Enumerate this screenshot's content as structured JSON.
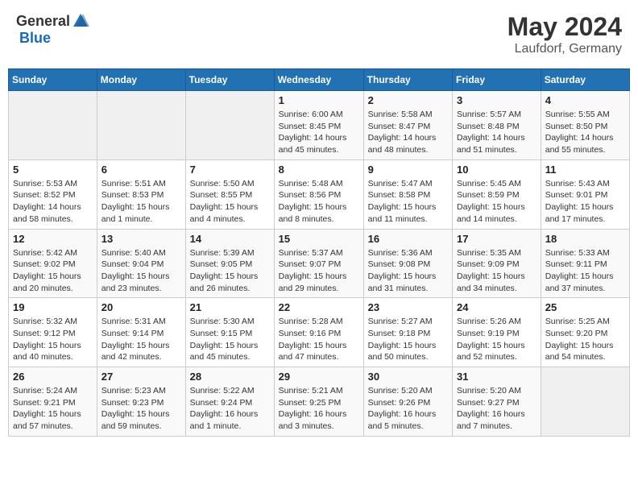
{
  "header": {
    "logo_general": "General",
    "logo_blue": "Blue",
    "month": "May 2024",
    "location": "Laufdorf, Germany"
  },
  "days_of_week": [
    "Sunday",
    "Monday",
    "Tuesday",
    "Wednesday",
    "Thursday",
    "Friday",
    "Saturday"
  ],
  "weeks": [
    [
      {
        "day": "",
        "info": ""
      },
      {
        "day": "",
        "info": ""
      },
      {
        "day": "",
        "info": ""
      },
      {
        "day": "1",
        "info": "Sunrise: 6:00 AM\nSunset: 8:45 PM\nDaylight: 14 hours\nand 45 minutes."
      },
      {
        "day": "2",
        "info": "Sunrise: 5:58 AM\nSunset: 8:47 PM\nDaylight: 14 hours\nand 48 minutes."
      },
      {
        "day": "3",
        "info": "Sunrise: 5:57 AM\nSunset: 8:48 PM\nDaylight: 14 hours\nand 51 minutes."
      },
      {
        "day": "4",
        "info": "Sunrise: 5:55 AM\nSunset: 8:50 PM\nDaylight: 14 hours\nand 55 minutes."
      }
    ],
    [
      {
        "day": "5",
        "info": "Sunrise: 5:53 AM\nSunset: 8:52 PM\nDaylight: 14 hours\nand 58 minutes."
      },
      {
        "day": "6",
        "info": "Sunrise: 5:51 AM\nSunset: 8:53 PM\nDaylight: 15 hours\nand 1 minute."
      },
      {
        "day": "7",
        "info": "Sunrise: 5:50 AM\nSunset: 8:55 PM\nDaylight: 15 hours\nand 4 minutes."
      },
      {
        "day": "8",
        "info": "Sunrise: 5:48 AM\nSunset: 8:56 PM\nDaylight: 15 hours\nand 8 minutes."
      },
      {
        "day": "9",
        "info": "Sunrise: 5:47 AM\nSunset: 8:58 PM\nDaylight: 15 hours\nand 11 minutes."
      },
      {
        "day": "10",
        "info": "Sunrise: 5:45 AM\nSunset: 8:59 PM\nDaylight: 15 hours\nand 14 minutes."
      },
      {
        "day": "11",
        "info": "Sunrise: 5:43 AM\nSunset: 9:01 PM\nDaylight: 15 hours\nand 17 minutes."
      }
    ],
    [
      {
        "day": "12",
        "info": "Sunrise: 5:42 AM\nSunset: 9:02 PM\nDaylight: 15 hours\nand 20 minutes."
      },
      {
        "day": "13",
        "info": "Sunrise: 5:40 AM\nSunset: 9:04 PM\nDaylight: 15 hours\nand 23 minutes."
      },
      {
        "day": "14",
        "info": "Sunrise: 5:39 AM\nSunset: 9:05 PM\nDaylight: 15 hours\nand 26 minutes."
      },
      {
        "day": "15",
        "info": "Sunrise: 5:37 AM\nSunset: 9:07 PM\nDaylight: 15 hours\nand 29 minutes."
      },
      {
        "day": "16",
        "info": "Sunrise: 5:36 AM\nSunset: 9:08 PM\nDaylight: 15 hours\nand 31 minutes."
      },
      {
        "day": "17",
        "info": "Sunrise: 5:35 AM\nSunset: 9:09 PM\nDaylight: 15 hours\nand 34 minutes."
      },
      {
        "day": "18",
        "info": "Sunrise: 5:33 AM\nSunset: 9:11 PM\nDaylight: 15 hours\nand 37 minutes."
      }
    ],
    [
      {
        "day": "19",
        "info": "Sunrise: 5:32 AM\nSunset: 9:12 PM\nDaylight: 15 hours\nand 40 minutes."
      },
      {
        "day": "20",
        "info": "Sunrise: 5:31 AM\nSunset: 9:14 PM\nDaylight: 15 hours\nand 42 minutes."
      },
      {
        "day": "21",
        "info": "Sunrise: 5:30 AM\nSunset: 9:15 PM\nDaylight: 15 hours\nand 45 minutes."
      },
      {
        "day": "22",
        "info": "Sunrise: 5:28 AM\nSunset: 9:16 PM\nDaylight: 15 hours\nand 47 minutes."
      },
      {
        "day": "23",
        "info": "Sunrise: 5:27 AM\nSunset: 9:18 PM\nDaylight: 15 hours\nand 50 minutes."
      },
      {
        "day": "24",
        "info": "Sunrise: 5:26 AM\nSunset: 9:19 PM\nDaylight: 15 hours\nand 52 minutes."
      },
      {
        "day": "25",
        "info": "Sunrise: 5:25 AM\nSunset: 9:20 PM\nDaylight: 15 hours\nand 54 minutes."
      }
    ],
    [
      {
        "day": "26",
        "info": "Sunrise: 5:24 AM\nSunset: 9:21 PM\nDaylight: 15 hours\nand 57 minutes."
      },
      {
        "day": "27",
        "info": "Sunrise: 5:23 AM\nSunset: 9:23 PM\nDaylight: 15 hours\nand 59 minutes."
      },
      {
        "day": "28",
        "info": "Sunrise: 5:22 AM\nSunset: 9:24 PM\nDaylight: 16 hours\nand 1 minute."
      },
      {
        "day": "29",
        "info": "Sunrise: 5:21 AM\nSunset: 9:25 PM\nDaylight: 16 hours\nand 3 minutes."
      },
      {
        "day": "30",
        "info": "Sunrise: 5:20 AM\nSunset: 9:26 PM\nDaylight: 16 hours\nand 5 minutes."
      },
      {
        "day": "31",
        "info": "Sunrise: 5:20 AM\nSunset: 9:27 PM\nDaylight: 16 hours\nand 7 minutes."
      },
      {
        "day": "",
        "info": ""
      }
    ]
  ]
}
